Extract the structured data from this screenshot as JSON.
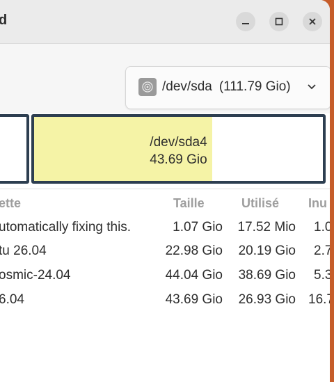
{
  "window": {
    "title": "d"
  },
  "device_selector": {
    "name": "/dev/sda",
    "size": "(111.79 Gio)",
    "icon": "disk-icon"
  },
  "partition_map": {
    "selected": {
      "name": "/dev/sda4",
      "size": "43.69 Gio",
      "used_fraction": 0.616
    },
    "used_color": "#f5f3a6",
    "border_color": "#2d3e50"
  },
  "table": {
    "headers": {
      "label": "ette",
      "size": "Taille",
      "used": "Utilisé",
      "unused": "Inu"
    },
    "rows": [
      {
        "label": "utomatically fixing this.",
        "size": "1.07 Gio",
        "used": "17.52 Mio",
        "unused": "1.0"
      },
      {
        "label": "tu 26.04",
        "size": "22.98 Gio",
        "used": "20.19 Gio",
        "unused": "2.7"
      },
      {
        "label": "osmic-24.04",
        "size": "44.04 Gio",
        "used": "38.69 Gio",
        "unused": "5.3"
      },
      {
        "label": "6.04",
        "size": "43.69 Gio",
        "used": "26.93 Gio",
        "unused": "16.7"
      }
    ]
  }
}
